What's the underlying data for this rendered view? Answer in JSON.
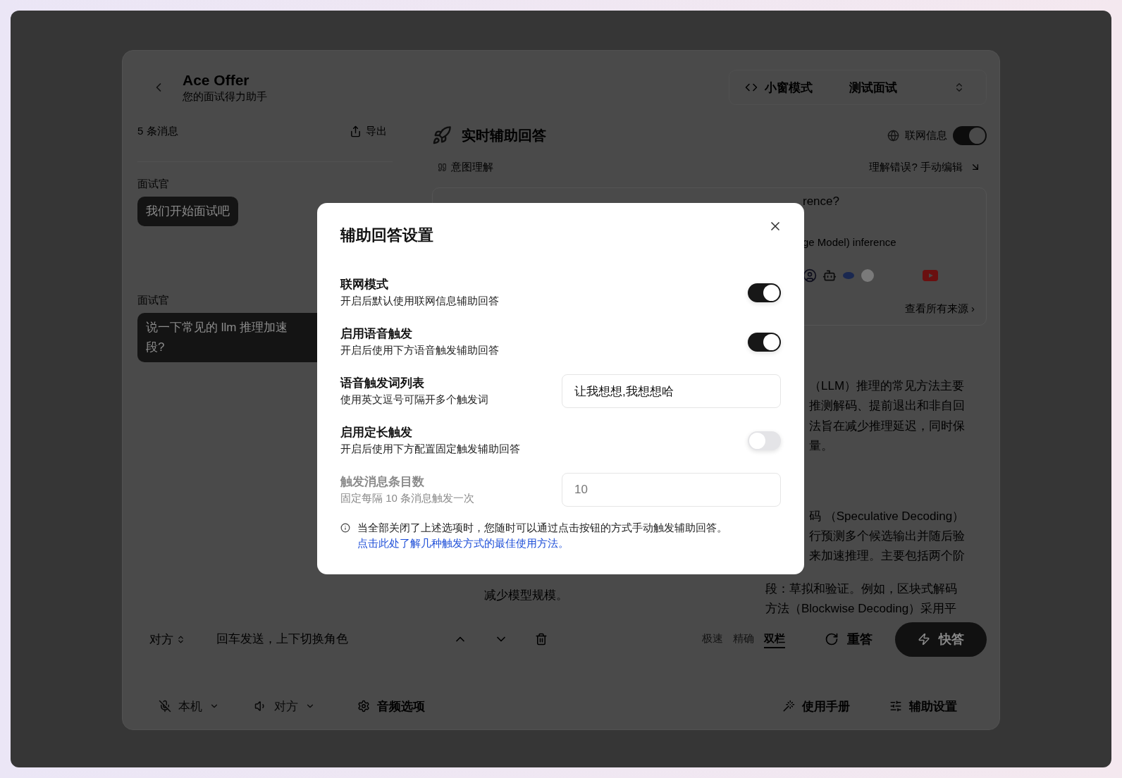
{
  "app": {
    "title": "Ace Offer",
    "subtitle": "您的面试得力助手"
  },
  "header": {
    "mini_mode": "小窗模式",
    "session": "测试面试"
  },
  "chat": {
    "count": "5 条消息",
    "export": "导出",
    "messages": [
      {
        "role": "面试官",
        "lines": [
          "我们开始面试吧"
        ]
      },
      {
        "role": "面试官",
        "lines": [
          "说一下常见的 llm 推理加速",
          "段?"
        ]
      }
    ]
  },
  "assistant": {
    "title": "实时辅助回答",
    "web_info": {
      "label": "联网信息",
      "on": true
    },
    "intent": {
      "label": "意图理解",
      "edit": "理解错误? 手动编辑"
    },
    "intent_lines": [
      "rence?",
      "ge Model) inference"
    ],
    "sources_link": "查看所有来源 ›",
    "left_column": {
      "lines": [
        "减少模型规模。"
      ]
    },
    "right_column": {
      "overlapped_lines": [
        "（LLM）推理的常见方法主要",
        "推测解码、提前退出和非自回",
        "法旨在减少推理延迟，同时保",
        "量。",
        "码 （Speculative Decoding）",
        "行预测多个候选输出并随后验",
        "来加速推理。主要包括两个阶"
      ],
      "lines": [
        "段：草拟和验证。例如，区块式解码",
        "方法（Blockwise Decoding）采用平"
      ]
    }
  },
  "input_bar": {
    "role": "对方",
    "placeholder": "回车发送，上下切换角色",
    "modes": [
      {
        "label": "极速",
        "selected": false
      },
      {
        "label": "精确",
        "selected": false
      },
      {
        "label": "双栏",
        "selected": true
      }
    ],
    "retry": "重答",
    "quick": "快答"
  },
  "footer": {
    "local": "本机",
    "remote": "对方",
    "audio": "音频选项",
    "manual": "使用手册",
    "settings": "辅助设置"
  },
  "dialog": {
    "title": "辅助回答设置",
    "rows": [
      {
        "kind": "toggle",
        "label": "联网模式",
        "description": "开启后默认使用联网信息辅助回答",
        "on": true,
        "disabled": false
      },
      {
        "kind": "toggle",
        "label": "启用语音触发",
        "description": "开启后使用下方语音触发辅助回答",
        "on": true,
        "disabled": false
      },
      {
        "kind": "input",
        "label": "语音触发词列表",
        "description": "使用英文逗号可隔开多个触发词",
        "value": "让我想想,我想想哈",
        "disabled": false
      },
      {
        "kind": "toggle",
        "label": "启用定长触发",
        "description": "开启后使用下方配置固定触发辅助回答",
        "on": false,
        "disabled": false
      },
      {
        "kind": "input",
        "label": "触发消息条目数",
        "description": "固定每隔 10 条消息触发一次",
        "value": "10",
        "disabled": true
      }
    ],
    "note": "当全部关闭了上述选项时，您随时可以通过点击按钮的方式手动触发辅助回答。",
    "note_link": "点击此处了解几种触发方式的最佳使用方法。"
  }
}
